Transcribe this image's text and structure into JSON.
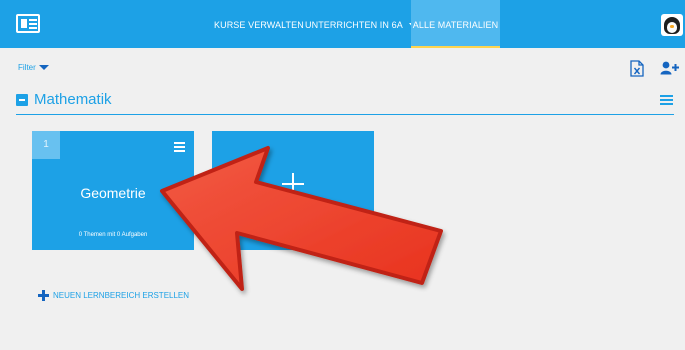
{
  "header": {
    "nav": [
      {
        "label": "KURSE VERWALTEN"
      },
      {
        "label": "UNTERRICHTEN IN 6A"
      },
      {
        "label": "ALLE MATERIALIEN"
      }
    ],
    "icons": {
      "app": "app-grid-icon",
      "avatar": "penguin-avatar",
      "nav_dropdown": "caret-down-icon"
    }
  },
  "toolbar": {
    "filter_label": "Filter",
    "icons": {
      "export": "excel-export-icon",
      "add_user": "add-user-icon"
    }
  },
  "section": {
    "title": "Mathematik",
    "icons": {
      "collapse": "minus-box-icon",
      "menu": "hamburger-menu-icon"
    }
  },
  "cards": [
    {
      "number": "1",
      "title": "Geometrie",
      "subtitle": "0 Themen mit 0 Aufgaben"
    }
  ],
  "add_card": {
    "icon": "plus-icon"
  },
  "new_area": {
    "label": "NEUEN LERNBEREICH ERSTELLEN",
    "icon": "plus-icon"
  },
  "annotation": {
    "icon": "red-arrow-pointer"
  },
  "colors": {
    "primary": "#1da1e6",
    "active_tab": "#4fb8ef",
    "background": "#f0f0f0",
    "arrow": "#ee3b2c"
  }
}
